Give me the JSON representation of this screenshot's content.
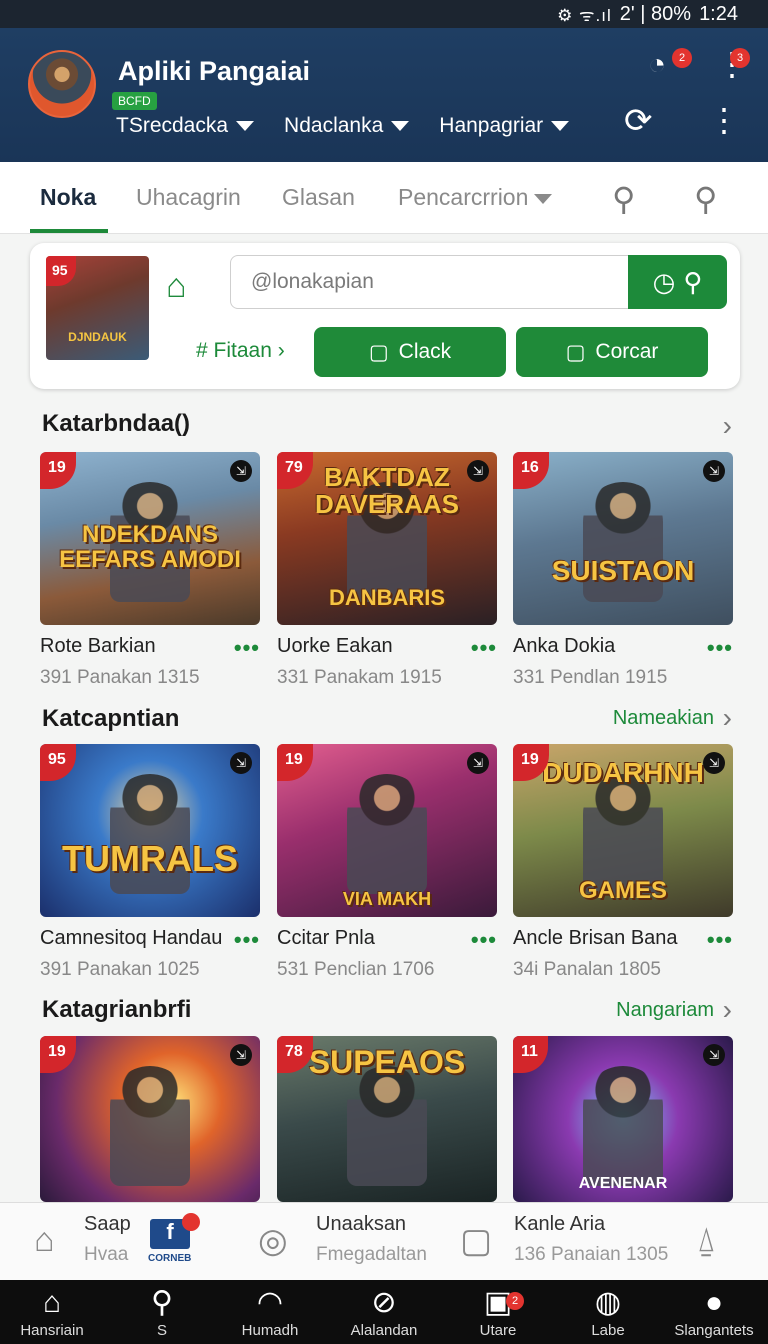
{
  "status_bar": {
    "icons": "⚙ ᯤ.ıl",
    "text": "2' | 80%",
    "time": "1:24"
  },
  "header": {
    "title": "Apliki Pangaiai",
    "badge": "BCFD",
    "dropdowns": [
      "TSrecdacka",
      "Ndaclanka",
      "Hanpagriar"
    ],
    "notif_count_1": "2",
    "notif_count_2": "3"
  },
  "tabs": [
    {
      "label": "Noka",
      "active": true
    },
    {
      "label": "Uhacagrin"
    },
    {
      "label": "Glasan"
    },
    {
      "label": "Pencarcrrion"
    }
  ],
  "search_card": {
    "thumb_rating": "95",
    "thumb_caption": "DJNDAUK",
    "placeholder": "@lonakapian",
    "filter_label": "# Fitaan",
    "button_1": "Clack",
    "button_2": "Corcar"
  },
  "sections": [
    {
      "title": "Katarbndaa()",
      "link": "",
      "games": [
        {
          "rating": "19",
          "title": "NDEKDANS EEFARS AMODI",
          "name": "Rote Barkian",
          "meta": "391 Panakan 1315",
          "bg": "linear-gradient(170deg,#8fb3cf 0%,#6a8aa6 35%,#8b5a3a 70%,#4b3a2a 100%)"
        },
        {
          "rating": "79",
          "title": "BAKTDAZ DAVERAAS",
          "subtitle": "DANBARIS",
          "name": "Uorke Eakan",
          "meta": "331 Panakam 1915",
          "bg": "linear-gradient(170deg,#c86a2e 0%,#8a3a22 40%,#2a2024 100%)"
        },
        {
          "rating": "16",
          "title": "SUISTAON",
          "name": "Anka Dokia",
          "meta": "331 Pendlan 1915",
          "bg": "linear-gradient(170deg,#8ab0c9 0%,#5d7891 45%,#3f4f5f 100%)"
        }
      ]
    },
    {
      "title": "Katcapntian",
      "link": "Nameakian",
      "games": [
        {
          "rating": "95",
          "title": "TUMRALS",
          "name": "Camnesitoq Handau",
          "meta": "391 Panakan 1025",
          "bg": "radial-gradient(circle at 50% 40%,#f0d9a0 0%,#3a7ac9 35%,#1b2f6b 100%)"
        },
        {
          "rating": "19",
          "title": "VIA MAKH",
          "name": "Ccitar Pnla",
          "meta": "531 Penclian 1706",
          "bg": "linear-gradient(160deg,#e35f8f 0%,#9a2f6d 40%,#3a1a3a 100%)"
        },
        {
          "rating": "19",
          "title": "DUDARHNH",
          "subtitle": "GAMES",
          "name": "Ancle Brisan Bana",
          "meta": "34i Panalan 1805",
          "bg": "linear-gradient(170deg,#c9a56a 0%,#7d8a4a 45%,#3f3a2a 100%)"
        }
      ]
    },
    {
      "title": "Katagrianbrfi",
      "link": "Nangariam",
      "games": [
        {
          "rating": "19",
          "title": "",
          "bg": "radial-gradient(circle at 60% 40%,#ffe27a 0%,#e0642a 30%,#6a2a6a 70%,#2a1a3a 100%)"
        },
        {
          "rating": "78",
          "title": "SUPEAOS",
          "bg": "linear-gradient(170deg,#6a7a6a 0%,#3a4a4a 45%,#1a2424 100%)"
        },
        {
          "rating": "11",
          "title": "AVENENAR",
          "bg": "radial-gradient(circle at 50% 50%,#7ad0ff 0%,#8a3ab0 40%,#2a1a4a 100%)"
        }
      ]
    }
  ],
  "mini_bar": {
    "item1_title": "Saap",
    "item1_sub": "Hvaa",
    "fb_label": "CORNEB",
    "item2_title": "Unaaksan",
    "item2_sub": "Fmegadaltan",
    "item3_title": "Kanle Aria",
    "item3_sub": "136 Panaian 1305"
  },
  "bottom_nav": [
    {
      "icon": "home-icon",
      "glyph": "⌂",
      "label": "Hansriain"
    },
    {
      "icon": "search-icon",
      "glyph": "⚲",
      "label": "S"
    },
    {
      "icon": "bell-icon",
      "glyph": "◠",
      "label": "Humadh"
    },
    {
      "icon": "compass-icon",
      "glyph": "⊘",
      "label": "Alalandan"
    },
    {
      "icon": "bag-icon",
      "glyph": "▣",
      "label": "Utare",
      "badge": "2"
    },
    {
      "icon": "globe-icon",
      "glyph": "◍",
      "label": "Labe"
    },
    {
      "icon": "user-icon",
      "glyph": "●",
      "label": "Slangantets"
    }
  ]
}
